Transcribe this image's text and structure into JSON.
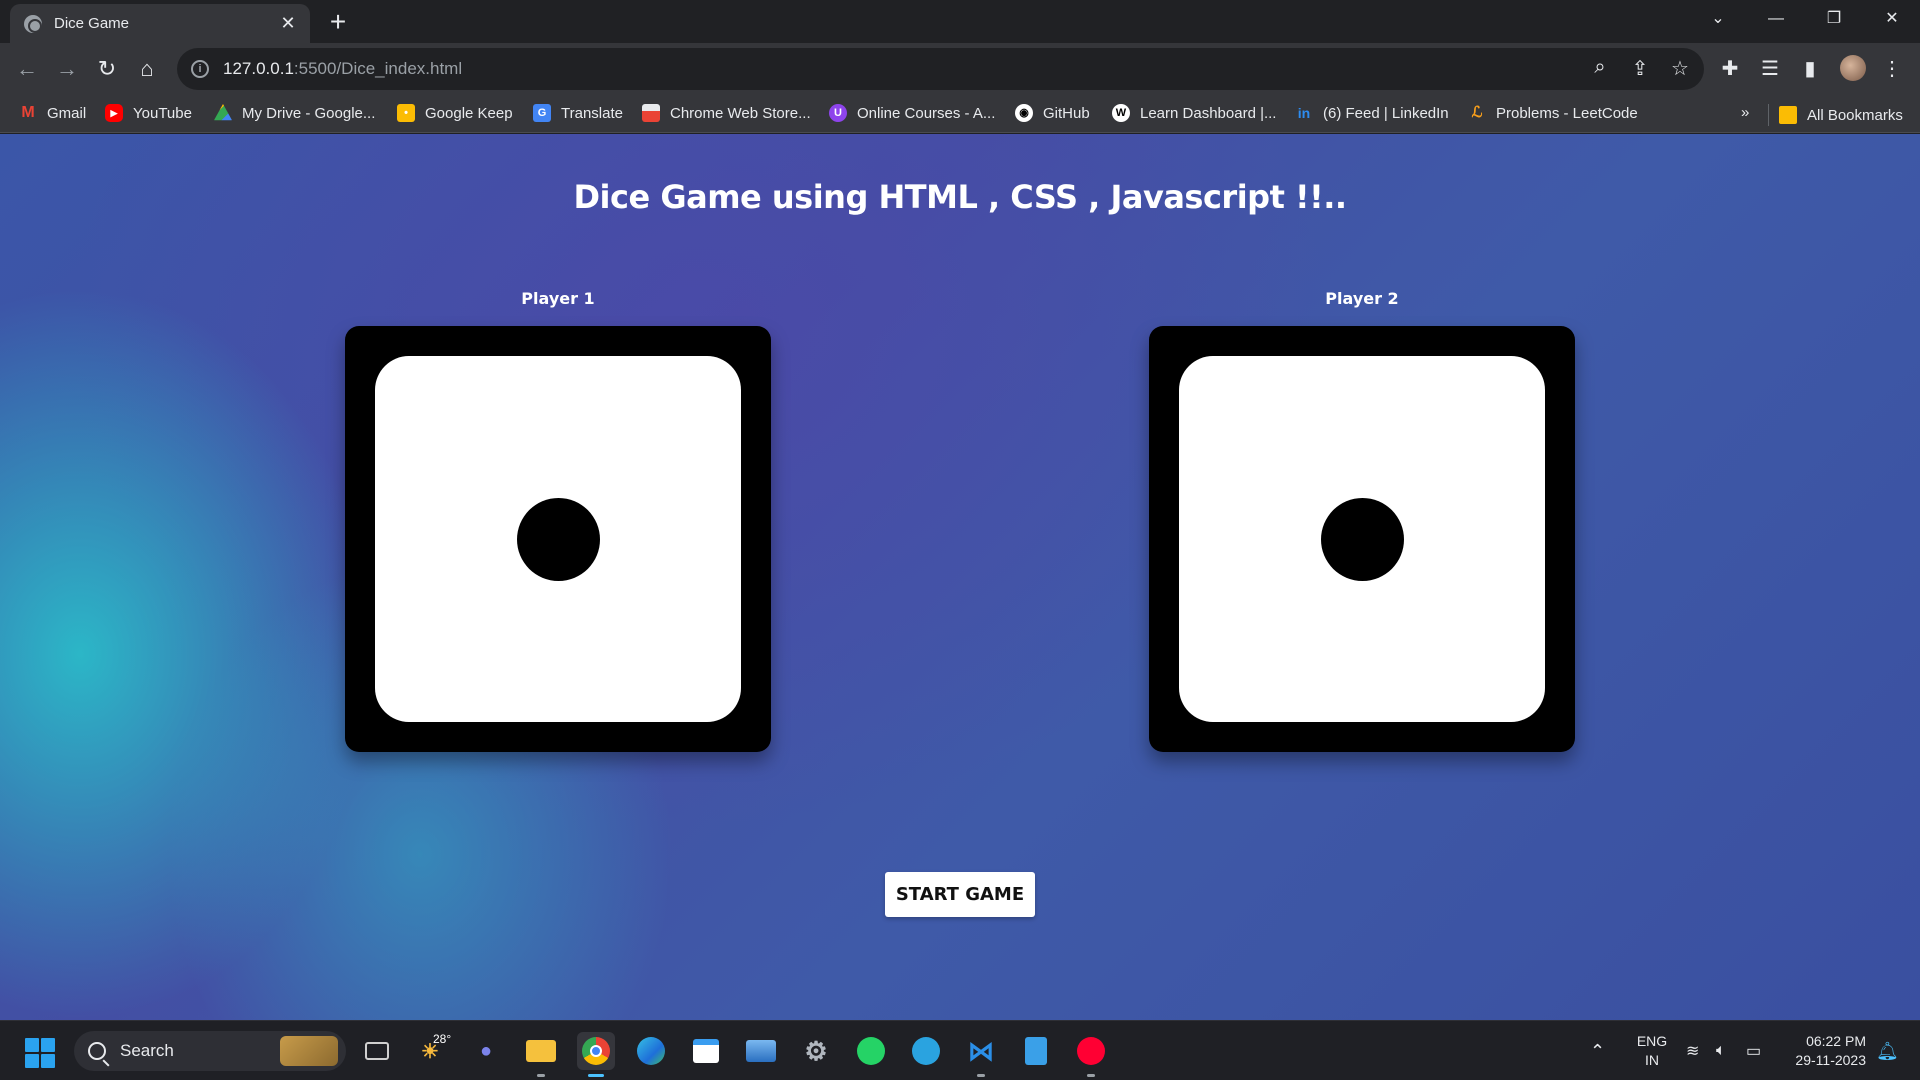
{
  "browser": {
    "tab_title": "Dice Game",
    "tab_close": "✕",
    "new_tab": "+",
    "window_controls": {
      "dropdown": "⌄",
      "minimize": "—",
      "restore": "❐",
      "close": "✕"
    },
    "url_host": "127.0.0.1",
    "url_rest": ":5500/Dice_index.html",
    "bookmarks": [
      {
        "label": "Gmail",
        "icon": "gmail-icon",
        "color": "#ea4335"
      },
      {
        "label": "YouTube",
        "icon": "youtube-icon",
        "color": "#ff0000"
      },
      {
        "label": "My Drive - Google...",
        "icon": "google-drive-icon",
        "color": "#34a853"
      },
      {
        "label": "Google Keep",
        "icon": "google-keep-icon",
        "color": "#fbbc04"
      },
      {
        "label": "Translate",
        "icon": "translate-icon",
        "color": "#4285f4"
      },
      {
        "label": "Chrome Web Store...",
        "icon": "web-store-icon",
        "color": "#e8eaed"
      },
      {
        "label": "Online Courses - A...",
        "icon": "courses-icon",
        "color": "#8e44ec"
      },
      {
        "label": "GitHub",
        "icon": "github-icon",
        "color": "#ffffff"
      },
      {
        "label": "Learn Dashboard |...",
        "icon": "wordpress-icon",
        "color": "#ffffff"
      },
      {
        "label": "(6) Feed | LinkedIn",
        "icon": "linkedin-icon",
        "color": "#0a66c2"
      },
      {
        "label": "Problems - LeetCode",
        "icon": "leetcode-icon",
        "color": "#f89f1b"
      }
    ],
    "overflow": "»",
    "all_bookmarks": "All Bookmarks"
  },
  "page": {
    "title": "Dice Game using HTML , CSS , Javascript !!..",
    "player1": {
      "label": "Player 1",
      "die_value": 1
    },
    "player2": {
      "label": "Player 2",
      "die_value": 1
    },
    "start_button": "START GAME"
  },
  "taskbar": {
    "search_label": "Search",
    "weather_temp": "28°",
    "language_top": "ENG",
    "language_bottom": "IN",
    "time": "06:22 PM",
    "date": "29-11-2023",
    "accent_color": "#4cc2ff"
  }
}
